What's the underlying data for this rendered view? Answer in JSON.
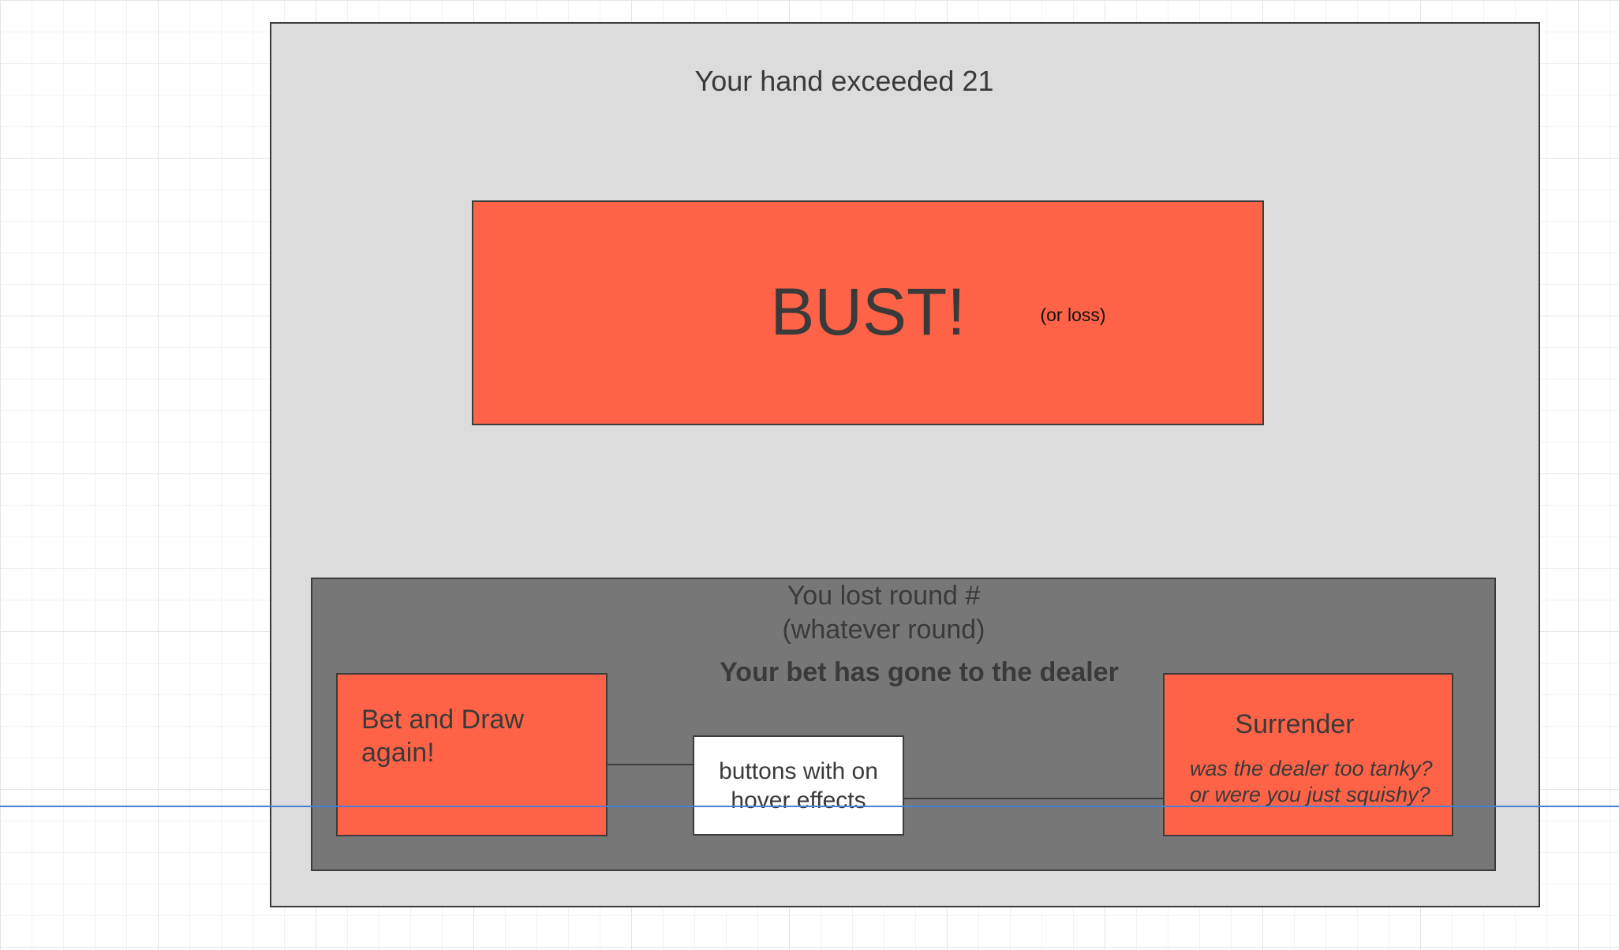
{
  "screen": {
    "heading": "Your hand exceeded 21",
    "result_title": "BUST!",
    "result_subtitle": "(or loss)"
  },
  "panel": {
    "lost_line_1": "You lost round #",
    "lost_line_2": "(whatever round)",
    "bet_message": "Your bet has gone to the dealer"
  },
  "buttons": {
    "bet_again_label": "Bet and Draw again!",
    "surrender_label": "Surrender",
    "surrender_hint": "was the dealer too tanky? or were you just squishy?"
  },
  "annotation": {
    "note_text": "buttons with on hover effects"
  },
  "colors": {
    "accent": "#ff6347",
    "frame_bg": "#dcdcdc",
    "panel_bg": "#777777",
    "note_bg": "#ffffff",
    "guide_line": "#4a7fd4"
  }
}
